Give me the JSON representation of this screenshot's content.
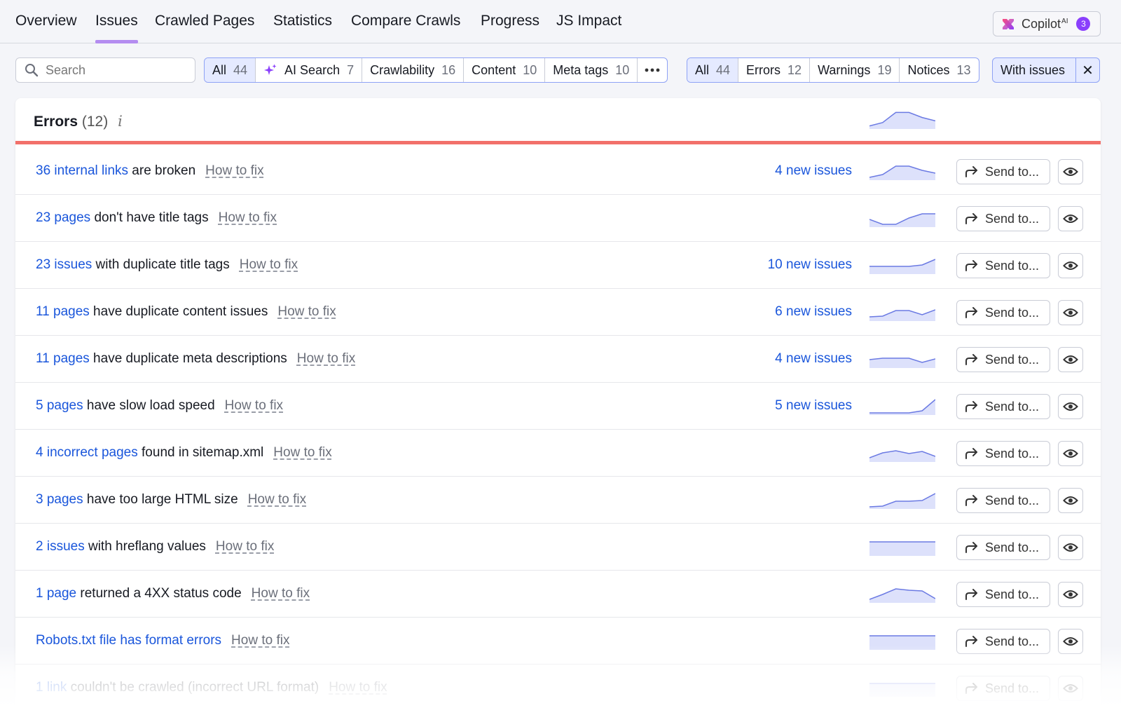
{
  "nav": {
    "tabs": [
      {
        "label": "Overview"
      },
      {
        "label": "Issues",
        "active": true
      },
      {
        "label": "Crawled Pages"
      },
      {
        "label": "Statistics"
      },
      {
        "label": "Compare Crawls"
      },
      {
        "label": "Progress"
      },
      {
        "label": "JS Impact"
      }
    ],
    "copilot": {
      "label": "Copilot",
      "suffix": "AI",
      "badge": "3"
    }
  },
  "search": {
    "placeholder": "Search",
    "value": ""
  },
  "category_filter": [
    {
      "label": "All",
      "count": "44",
      "selected": true
    },
    {
      "label": "AI Search",
      "count": "7",
      "icon": "sparkle-icon"
    },
    {
      "label": "Crawlability",
      "count": "16"
    },
    {
      "label": "Content",
      "count": "10"
    },
    {
      "label": "Meta tags",
      "count": "10"
    },
    {
      "label": "more",
      "icon": "more-dots-icon"
    }
  ],
  "severity_filter": [
    {
      "label": "All",
      "count": "44",
      "selected": true
    },
    {
      "label": "Errors",
      "count": "12"
    },
    {
      "label": "Warnings",
      "count": "19"
    },
    {
      "label": "Notices",
      "count": "13"
    }
  ],
  "with_issues": {
    "label": "With issues",
    "close": "✕"
  },
  "section": {
    "title": "Errors",
    "count": "(12)",
    "info": "i",
    "accent_color": "#f2706a"
  },
  "labels": {
    "how_to_fix": "How to fix",
    "send_to": "Send to..."
  },
  "colors": {
    "link": "#1a56db",
    "spark_fill": "#dde1fb",
    "spark_line": "#6b7ae3"
  },
  "issues": [
    {
      "link": "36 internal links",
      "text": " are broken",
      "new": "4 new issues",
      "trend": [
        0.1,
        0.3,
        0.9,
        0.9,
        0.6,
        0.4
      ]
    },
    {
      "link": "23 pages",
      "text": " don't have title tags",
      "new": "",
      "trend": [
        0.45,
        0.1,
        0.1,
        0.55,
        0.85,
        0.85
      ]
    },
    {
      "link": "23 issues",
      "text": " with duplicate title tags",
      "new": "10 new issues",
      "trend": [
        0.45,
        0.45,
        0.45,
        0.45,
        0.55,
        0.95
      ]
    },
    {
      "link": "11 pages",
      "text": " have duplicate content issues",
      "new": "6 new issues",
      "trend": [
        0.2,
        0.25,
        0.65,
        0.65,
        0.35,
        0.7
      ]
    },
    {
      "link": "11 pages",
      "text": " have duplicate meta descriptions",
      "new": "4 new issues",
      "trend": [
        0.5,
        0.6,
        0.6,
        0.6,
        0.3,
        0.55
      ]
    },
    {
      "link": "5 pages",
      "text": " have slow load speed",
      "new": "5 new issues",
      "trend": [
        0.05,
        0.05,
        0.05,
        0.05,
        0.2,
        1.0
      ]
    },
    {
      "link": "4 incorrect pages",
      "text": " found in sitemap.xml",
      "new": "",
      "trend": [
        0.2,
        0.55,
        0.7,
        0.5,
        0.65,
        0.3
      ]
    },
    {
      "link": "3 pages",
      "text": " have too large HTML size",
      "new": "",
      "trend": [
        0.05,
        0.1,
        0.45,
        0.45,
        0.5,
        1.0
      ]
    },
    {
      "link": "2 issues",
      "text": " with hreflang values",
      "new": "",
      "trend": [
        0.9,
        0.9,
        0.9,
        0.9,
        0.9,
        0.9
      ]
    },
    {
      "link": "1 page",
      "text": " returned a 4XX status code",
      "new": "",
      "trend": [
        0.15,
        0.5,
        0.9,
        0.8,
        0.75,
        0.2
      ]
    },
    {
      "link": "Robots.txt file has format errors",
      "text": "",
      "new": "",
      "trend": [
        0.9,
        0.9,
        0.9,
        0.9,
        0.9,
        0.9
      ]
    },
    {
      "link": "1 link",
      "text": " couldn't be crawled (incorrect URL format)",
      "new": "",
      "trend": [
        0.85,
        0.85,
        0.85,
        0.85,
        0.85,
        0.85
      ]
    }
  ],
  "header_trend": [
    0.1,
    0.3,
    0.9,
    0.9,
    0.6,
    0.4
  ]
}
